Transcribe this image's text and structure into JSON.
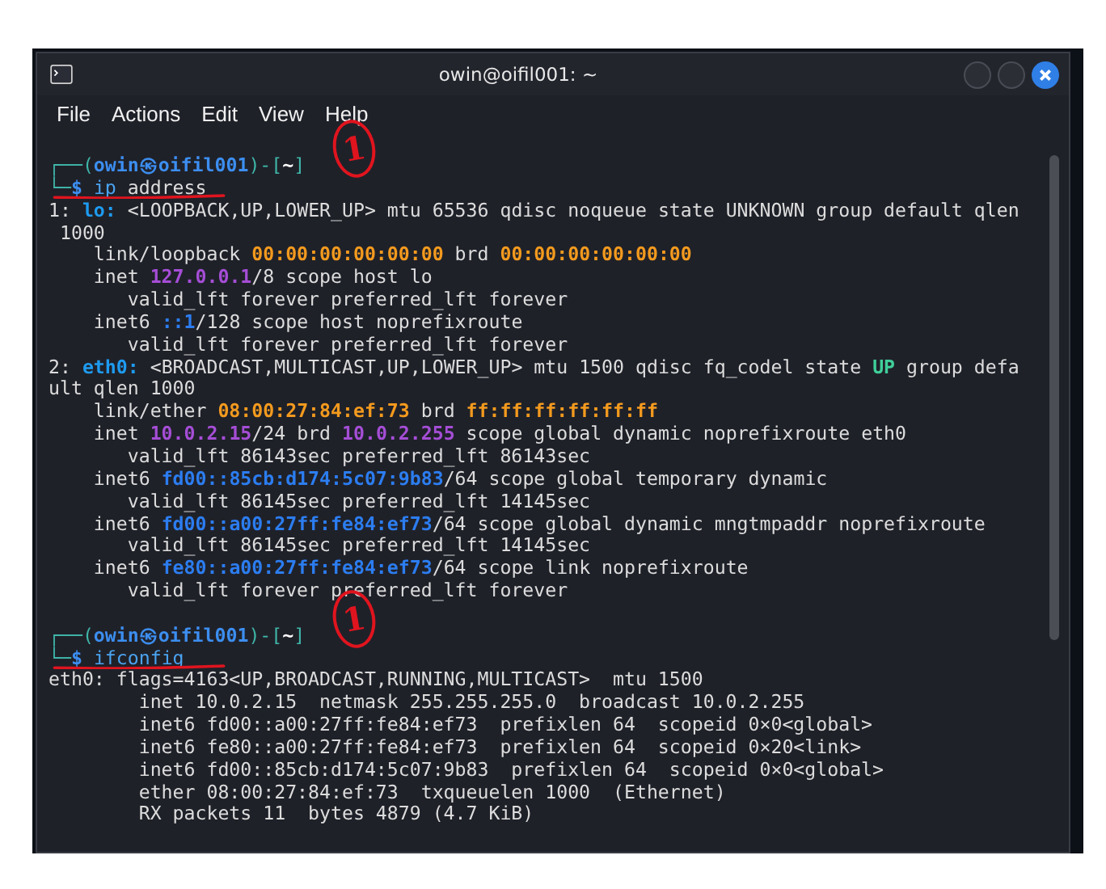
{
  "window": {
    "title": "owin@oifil001: ~"
  },
  "menu": [
    "File",
    "Actions",
    "Edit",
    "View",
    "Help"
  ],
  "terminal": {
    "blocks": [
      {
        "annotation": "1",
        "underlined": true,
        "prompt_head": [
          {
            "kind": "frame",
            "text": "┌──("
          },
          {
            "kind": "user",
            "text": "owin㉿oifil001"
          },
          {
            "kind": "frame",
            "text": ")-["
          },
          {
            "kind": "path",
            "text": "~"
          },
          {
            "kind": "frame",
            "text": "]"
          }
        ],
        "prompt_command": [
          {
            "kind": "frame",
            "text": "└─"
          },
          {
            "kind": "dollar",
            "text": "$ "
          },
          {
            "kind": "command",
            "text": "ip"
          },
          {
            "kind": "plain",
            "text": " address"
          }
        ],
        "output": [
          [
            {
              "kind": "plain",
              "text": "1: "
            },
            {
              "kind": "iface",
              "text": "lo:"
            },
            {
              "kind": "plain",
              "text": " <LOOPBACK,UP,LOWER_UP> mtu 65536 qdisc noqueue state UNKNOWN group default qlen"
            }
          ],
          [
            {
              "kind": "plain",
              "text": " 1000"
            }
          ],
          [
            {
              "kind": "plain",
              "text": "    link/loopback "
            },
            {
              "kind": "mac",
              "text": "00:00:00:00:00:00"
            },
            {
              "kind": "plain",
              "text": " brd "
            },
            {
              "kind": "mac",
              "text": "00:00:00:00:00:00"
            }
          ],
          [
            {
              "kind": "plain",
              "text": "    inet "
            },
            {
              "kind": "ipv4",
              "text": "127.0.0.1"
            },
            {
              "kind": "plain",
              "text": "/8 scope host lo"
            }
          ],
          [
            {
              "kind": "plain",
              "text": "       valid_lft forever preferred_lft forever"
            }
          ],
          [
            {
              "kind": "plain",
              "text": "    inet6 "
            },
            {
              "kind": "ipv6",
              "text": "::1"
            },
            {
              "kind": "plain",
              "text": "/128 scope host noprefixroute"
            }
          ],
          [
            {
              "kind": "plain",
              "text": "       valid_lft forever preferred_lft forever"
            }
          ],
          [
            {
              "kind": "plain",
              "text": "2: "
            },
            {
              "kind": "iface",
              "text": "eth0:"
            },
            {
              "kind": "plain",
              "text": " <BROADCAST,MULTICAST,UP,LOWER_UP> mtu 1500 qdisc fq_codel state "
            },
            {
              "kind": "state",
              "text": "UP"
            },
            {
              "kind": "plain",
              "text": " group defa"
            }
          ],
          [
            {
              "kind": "plain",
              "text": "ult qlen 1000"
            }
          ],
          [
            {
              "kind": "plain",
              "text": "    link/ether "
            },
            {
              "kind": "mac",
              "text": "08:00:27:84:ef:73"
            },
            {
              "kind": "plain",
              "text": " brd "
            },
            {
              "kind": "mac",
              "text": "ff:ff:ff:ff:ff:ff"
            }
          ],
          [
            {
              "kind": "plain",
              "text": "    inet "
            },
            {
              "kind": "ipv4",
              "text": "10.0.2.15"
            },
            {
              "kind": "plain",
              "text": "/24 brd "
            },
            {
              "kind": "ipv4",
              "text": "10.0.2.255"
            },
            {
              "kind": "plain",
              "text": " scope global dynamic noprefixroute eth0"
            }
          ],
          [
            {
              "kind": "plain",
              "text": "       valid_lft 86143sec preferred_lft 86143sec"
            }
          ],
          [
            {
              "kind": "plain",
              "text": "    inet6 "
            },
            {
              "kind": "ipv6",
              "text": "fd00::85cb:d174:5c07:9b83"
            },
            {
              "kind": "plain",
              "text": "/64 scope global temporary dynamic"
            }
          ],
          [
            {
              "kind": "plain",
              "text": "       valid_lft 86145sec preferred_lft 14145sec"
            }
          ],
          [
            {
              "kind": "plain",
              "text": "    inet6 "
            },
            {
              "kind": "ipv6",
              "text": "fd00::a00:27ff:fe84:ef73"
            },
            {
              "kind": "plain",
              "text": "/64 scope global dynamic mngtmpaddr noprefixroute"
            }
          ],
          [
            {
              "kind": "plain",
              "text": "       valid_lft 86145sec preferred_lft 14145sec"
            }
          ],
          [
            {
              "kind": "plain",
              "text": "    inet6 "
            },
            {
              "kind": "ipv6",
              "text": "fe80::a00:27ff:fe84:ef73"
            },
            {
              "kind": "plain",
              "text": "/64 scope link noprefixroute"
            }
          ],
          [
            {
              "kind": "plain",
              "text": "       valid_lft forever preferred_lft forever"
            }
          ]
        ]
      },
      {
        "annotation": "1",
        "underlined": true,
        "prompt_head": [
          {
            "kind": "frame",
            "text": "┌──("
          },
          {
            "kind": "user",
            "text": "owin㉿oifil001"
          },
          {
            "kind": "frame",
            "text": ")-["
          },
          {
            "kind": "path",
            "text": "~"
          },
          {
            "kind": "frame",
            "text": "]"
          }
        ],
        "prompt_command": [
          {
            "kind": "frame",
            "text": "└─"
          },
          {
            "kind": "dollar",
            "text": "$ "
          },
          {
            "kind": "command",
            "text": "ifconfig"
          }
        ],
        "output": [
          [
            {
              "kind": "plain",
              "text": "eth0: flags=4163<UP,BROADCAST,RUNNING,MULTICAST>  mtu 1500"
            }
          ],
          [
            {
              "kind": "plain",
              "text": "        inet 10.0.2.15  netmask 255.255.255.0  broadcast 10.0.2.255"
            }
          ],
          [
            {
              "kind": "plain",
              "text": "        inet6 fd00::a00:27ff:fe84:ef73  prefixlen 64  scopeid 0×0<global>"
            }
          ],
          [
            {
              "kind": "plain",
              "text": "        inet6 fe80::a00:27ff:fe84:ef73  prefixlen 64  scopeid 0×20<link>"
            }
          ],
          [
            {
              "kind": "plain",
              "text": "        inet6 fd00::85cb:d174:5c07:9b83  prefixlen 64  scopeid 0×0<global>"
            }
          ],
          [
            {
              "kind": "plain",
              "text": "        ether 08:00:27:84:ef:73  txqueuelen 1000  (Ethernet)"
            }
          ],
          [
            {
              "kind": "plain",
              "text": "        RX packets 11  bytes 4879 (4.7 KiB)"
            }
          ]
        ]
      }
    ]
  }
}
